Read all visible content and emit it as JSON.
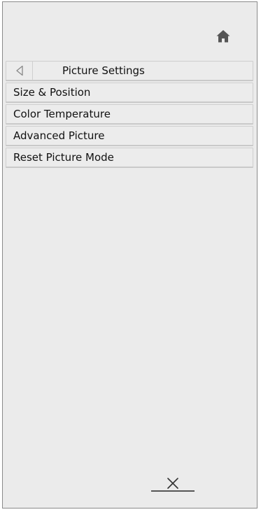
{
  "header": {
    "home_icon": "home-icon",
    "back_icon": "back-triangle-icon",
    "title": "Picture Settings"
  },
  "menu": {
    "items": [
      {
        "label": "Size & Position"
      },
      {
        "label": "Color Temperature"
      },
      {
        "label": "Advanced Picture"
      },
      {
        "label": "Reset Picture Mode"
      }
    ]
  },
  "footer": {
    "close_icon": "close-icon"
  },
  "colors": {
    "panel_bg": "#ebebeb",
    "row_bg": "#ececec",
    "text": "#111111"
  }
}
